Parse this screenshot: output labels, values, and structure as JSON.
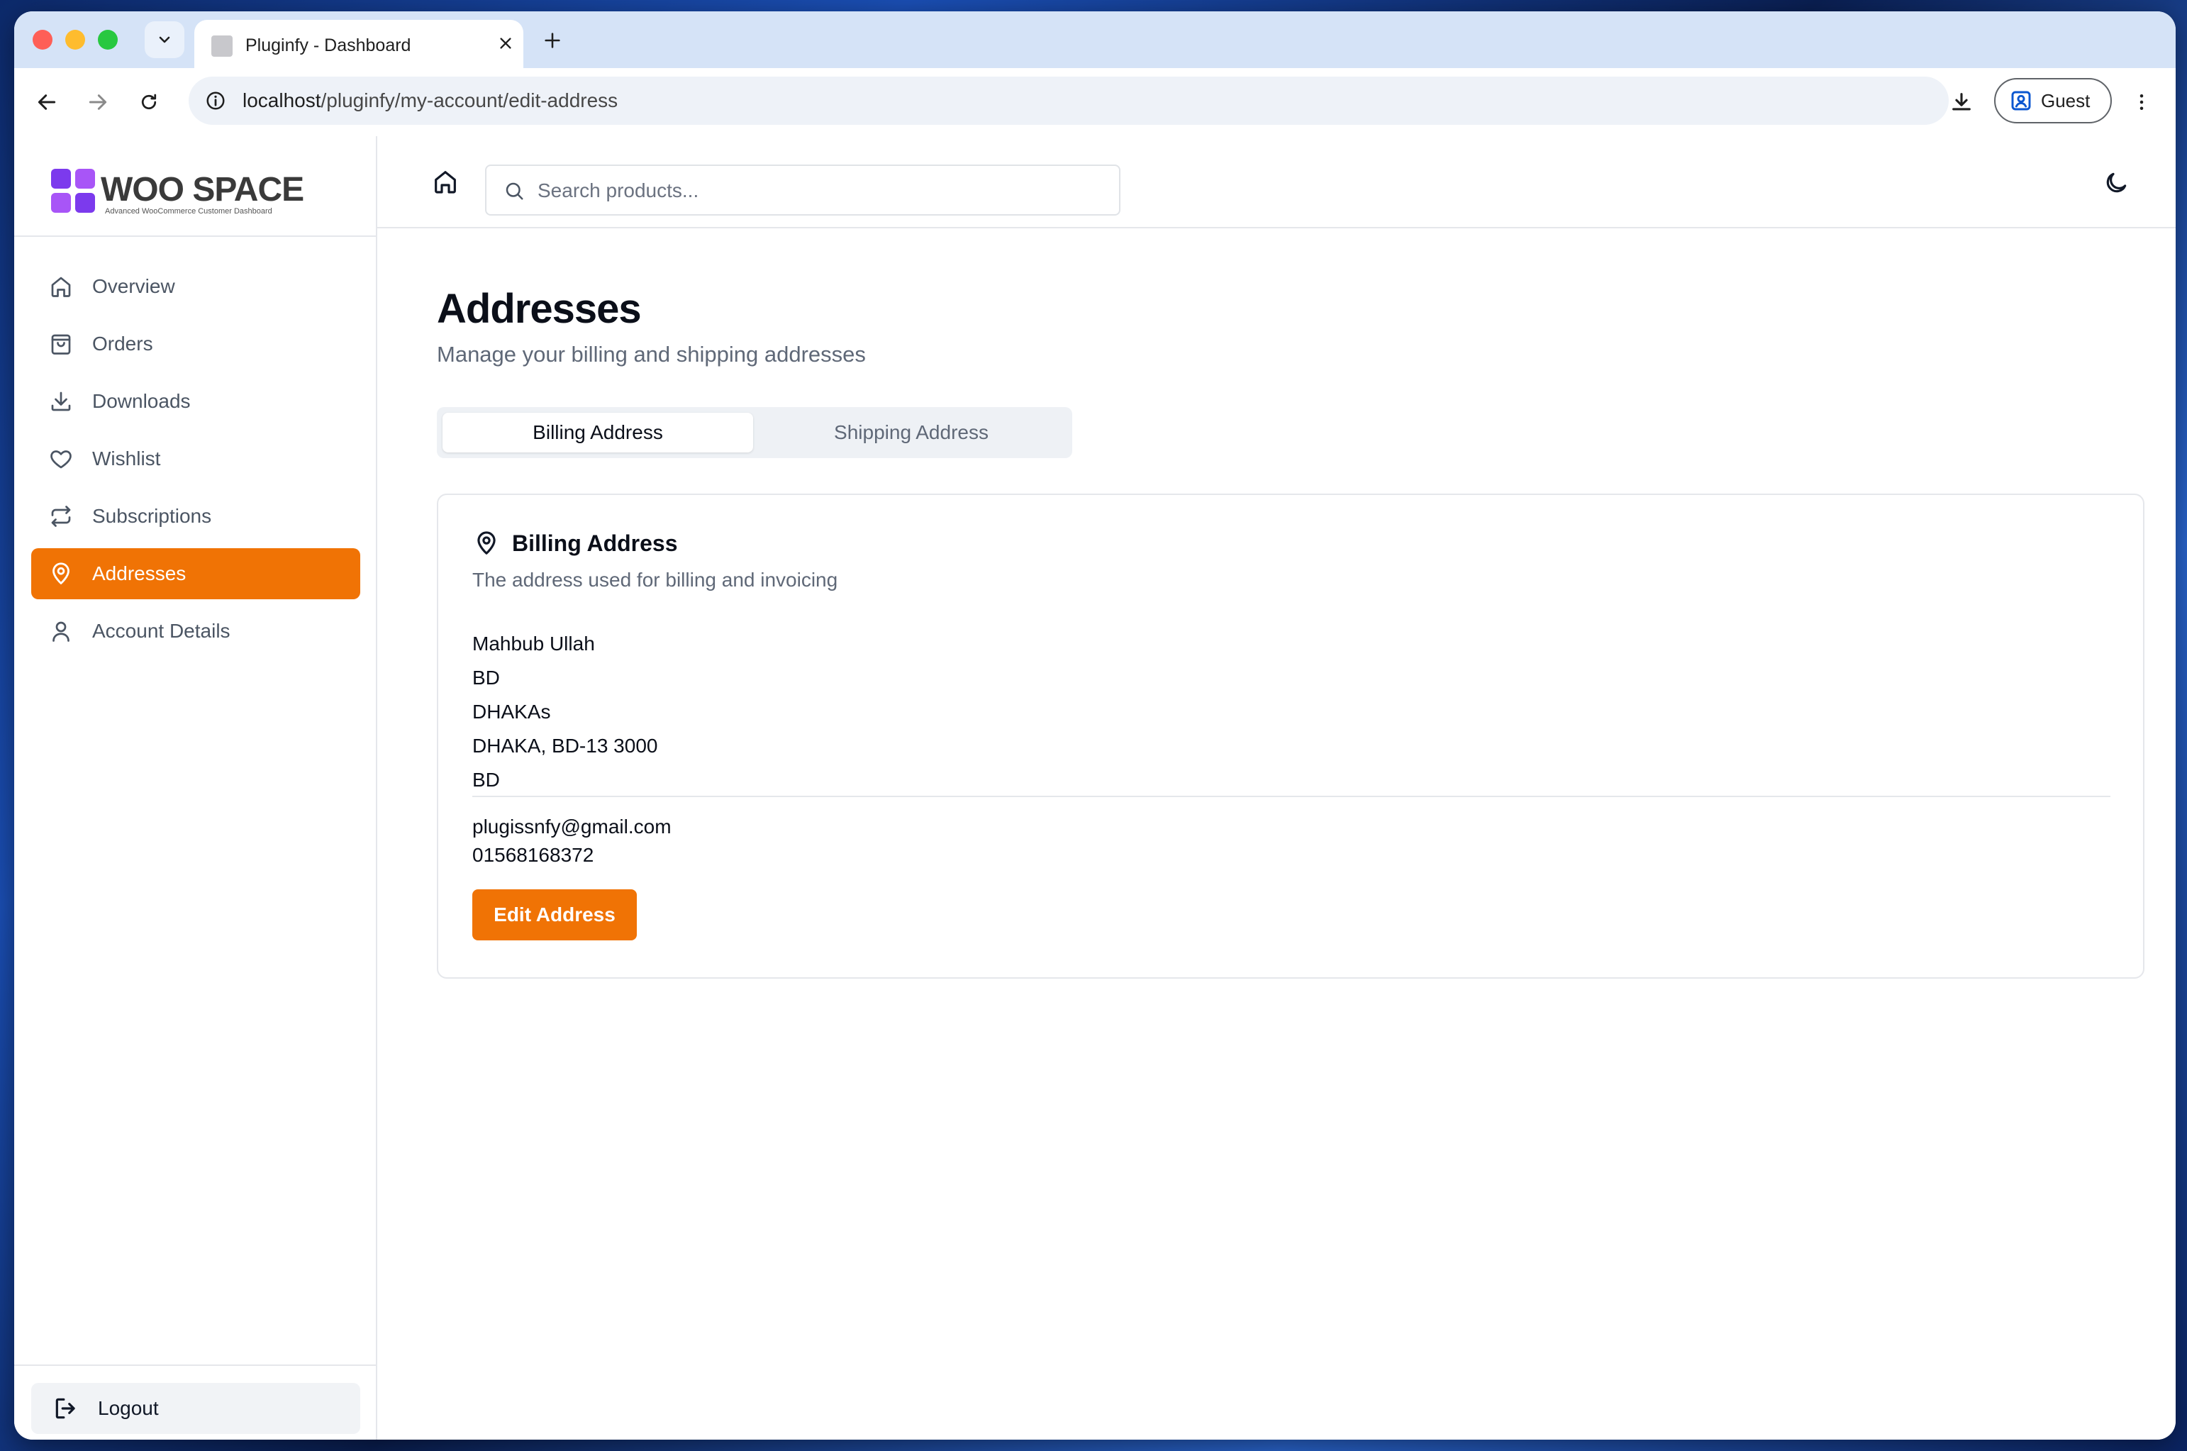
{
  "browser": {
    "tab_title": "Pluginfy - Dashboard",
    "url_host": "localhost",
    "url_path": "/pluginfy/my-account/edit-address",
    "profile_label": "Guest"
  },
  "brand": {
    "name": "WOO SPACE",
    "tagline": "Advanced WooCommerce Customer Dashboard",
    "accent_color": "#f07305",
    "logo_color": "#7c3aed"
  },
  "sidebar": {
    "items": [
      {
        "label": "Overview",
        "icon": "home-icon"
      },
      {
        "label": "Orders",
        "icon": "shopping-bag-icon"
      },
      {
        "label": "Downloads",
        "icon": "download-icon"
      },
      {
        "label": "Wishlist",
        "icon": "heart-icon"
      },
      {
        "label": "Subscriptions",
        "icon": "repeat-icon"
      },
      {
        "label": "Addresses",
        "icon": "map-pin-icon",
        "active": true
      },
      {
        "label": "Account Details",
        "icon": "user-icon"
      }
    ],
    "logout_label": "Logout"
  },
  "topbar": {
    "search_placeholder": "Search products..."
  },
  "page": {
    "title": "Addresses",
    "subtitle": "Manage your billing and shipping addresses",
    "tabs": [
      {
        "label": "Billing Address",
        "active": true
      },
      {
        "label": "Shipping Address",
        "active": false
      }
    ]
  },
  "billing_card": {
    "title": "Billing Address",
    "description": "The address used for billing and invoicing",
    "name": "Mahbub Ullah",
    "line1": "BD",
    "line2": "DHAKAs",
    "line3": "DHAKA, BD-13 3000",
    "country": "BD",
    "email": "plugissnfy@gmail.com",
    "phone": "01568168372",
    "edit_label": "Edit Address"
  }
}
